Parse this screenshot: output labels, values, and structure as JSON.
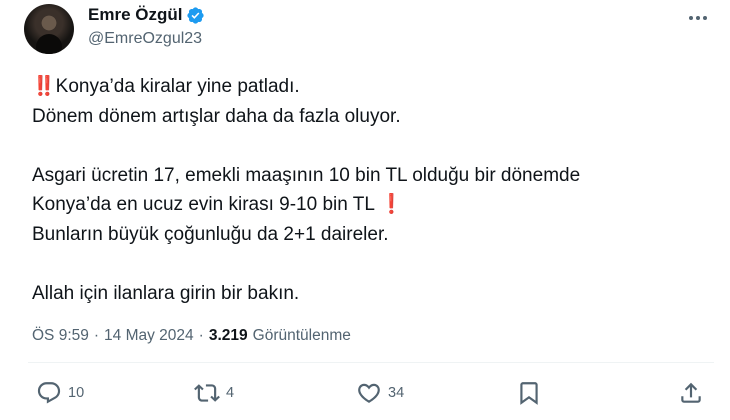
{
  "author": {
    "display_name": "Emre Özgül",
    "handle": "@EmreOzgul23",
    "verified": true
  },
  "tweet": {
    "line1_emoji": "‼️",
    "line1_text": "Konya’da kiralar yine patladı.",
    "line2": "Dönem dönem artışlar daha da fazla oluyor.",
    "line3": "Asgari ücretin 17, emekli maaşının 10 bin TL olduğu bir dönemde",
    "line4_text": "Konya’da en ucuz evin kirası 9-10 bin TL",
    "line4_emoji": "❗",
    "line5": "Bunların büyük çoğunluğu da 2+1 daireler.",
    "line6": "Allah için ilanlara girin bir bakın."
  },
  "meta": {
    "time": "ÖS 9:59",
    "separator1": "·",
    "date": "14 May 2024",
    "separator2": "·",
    "views_count": "3.219",
    "views_label": "Görüntülenme"
  },
  "actions": {
    "replies": "10",
    "retweets": "4",
    "likes": "34"
  },
  "icons": {
    "verified": "verified-badge-icon",
    "more": "more-horizontal-icon",
    "reply": "reply-icon",
    "retweet": "retweet-icon",
    "like": "heart-icon",
    "bookmark": "bookmark-icon",
    "share": "share-icon"
  },
  "colors": {
    "verified": "#1d9bf0",
    "text_primary": "#0f1419",
    "text_secondary": "#536471",
    "emoji_red": "#e0202b"
  }
}
